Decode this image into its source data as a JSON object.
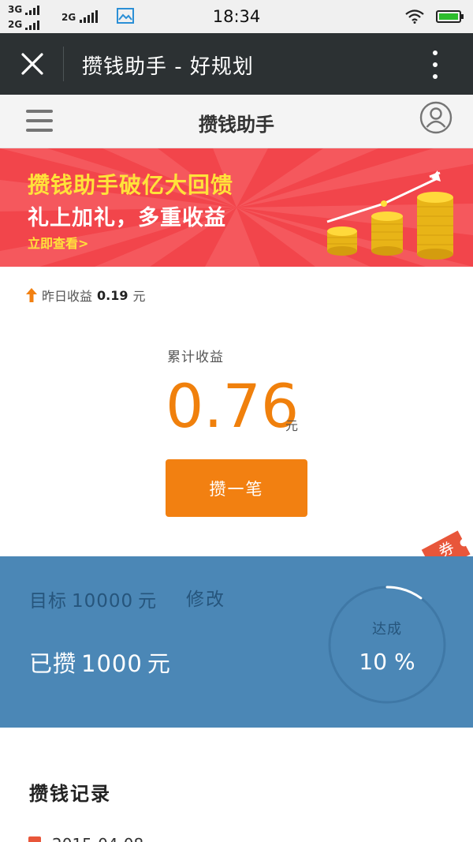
{
  "status_bar": {
    "network_1": "3G",
    "network_2": "2G",
    "network_3": "2G",
    "time": "18:34"
  },
  "title_bar": {
    "title": "攒钱助手 - 好规划"
  },
  "app_header": {
    "title": "攒钱助手"
  },
  "banner": {
    "headline": "攒钱助手破亿大回馈",
    "subline": "礼上加礼，多重收益",
    "link": "立即查看>"
  },
  "earnings": {
    "yesterday_label": "昨日收益",
    "yesterday_value": "0.19",
    "yesterday_unit": "元",
    "total_label": "累计收益",
    "total_value": "0.76",
    "total_unit": "元",
    "save_button": "攒一笔"
  },
  "coupon": {
    "label": "券"
  },
  "goal": {
    "target_label": "目标",
    "target_amount": "10000",
    "target_unit": "元",
    "edit_label": "修改",
    "saved_label": "已攒",
    "saved_amount": "1000",
    "saved_unit": "元",
    "progress_label": "达成",
    "progress_text": "10 %",
    "progress_fraction": 0.1
  },
  "records": {
    "title": "攒钱记录",
    "first_date": "2015-04-08"
  },
  "colors": {
    "accent_orange": "#f28011",
    "banner_red": "#f2454b",
    "goal_blue": "#4b87b6",
    "title_bar_dark": "#2c3133"
  },
  "icons": {
    "close": "close-icon",
    "more": "more-vertical-icon",
    "menu": "menu-icon",
    "user": "user-icon",
    "wifi": "wifi-icon",
    "battery": "battery-icon",
    "gallery": "gallery-icon",
    "up_arrow": "up-arrow-icon"
  }
}
